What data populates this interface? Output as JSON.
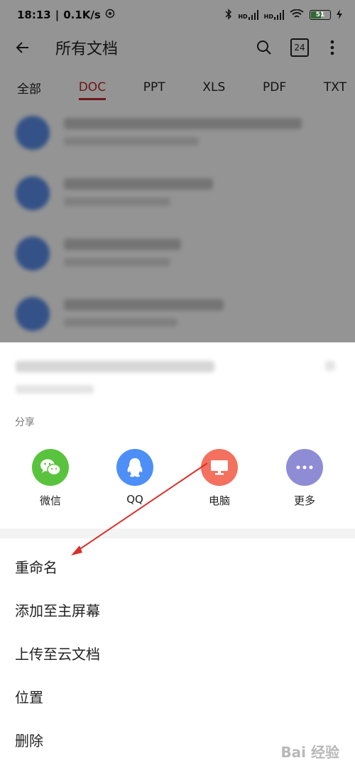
{
  "status_bar": {
    "time": "18:13",
    "speed": "0.1K/s",
    "battery": "51",
    "hd1": "HD",
    "hd2": "HD",
    "battery_level": 0.51
  },
  "app_bar": {
    "back_icon": "arrow-left-icon",
    "title": "所有文档",
    "search_icon": "search-icon",
    "calendar_badge": "24",
    "more_icon": "vertical-dots-icon"
  },
  "tabs": [
    {
      "label": "全部",
      "active": false
    },
    {
      "label": "DOC",
      "active": true
    },
    {
      "label": "PPT",
      "active": false
    },
    {
      "label": "XLS",
      "active": false
    },
    {
      "label": "PDF",
      "active": false
    },
    {
      "label": "TXT",
      "active": false
    }
  ],
  "sheet": {
    "share_label": "分享",
    "share_targets": [
      {
        "label": "微信",
        "icon": "wechat-icon",
        "color": "#5ac33e"
      },
      {
        "label": "QQ",
        "icon": "qq-icon",
        "color": "#4e8ef7"
      },
      {
        "label": "电脑",
        "icon": "monitor-icon",
        "color": "#f4705f"
      },
      {
        "label": "更多",
        "icon": "more-dots-icon",
        "color": "#8f8cd6"
      }
    ],
    "menu": [
      {
        "label": "重命名"
      },
      {
        "label": "添加至主屏幕"
      },
      {
        "label": "上传至云文档"
      },
      {
        "label": "位置"
      },
      {
        "label": "删除"
      }
    ]
  },
  "colors": {
    "accent": "#c3272b",
    "annotation_arrow": "#d9302b"
  },
  "watermark": "Bai 经验"
}
